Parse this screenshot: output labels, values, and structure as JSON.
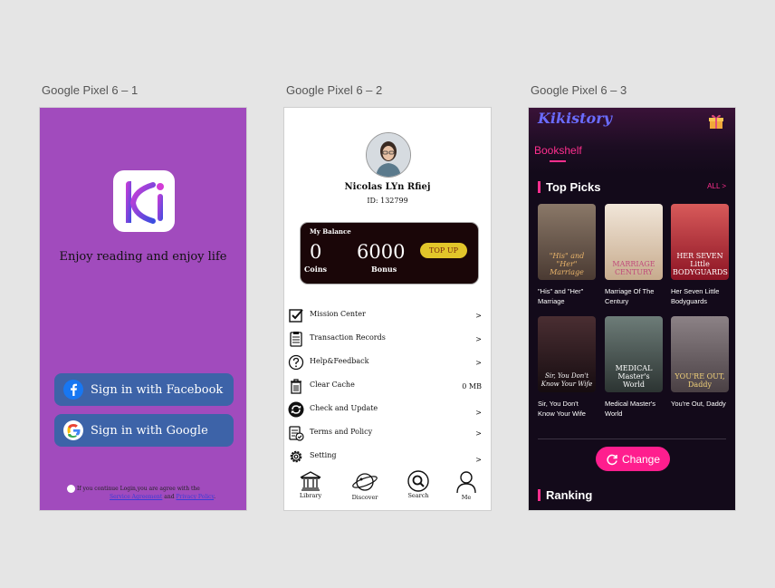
{
  "frames": {
    "f1_label": "Google Pixel 6 – 1",
    "f2_label": "Google Pixel 6 – 2",
    "f3_label": "Google Pixel 6 – 3"
  },
  "login": {
    "tagline": "Enjoy reading and enjoy life",
    "facebook_button": "Sign in with Facebook",
    "google_button": "Sign in with Google",
    "agreement_text": "If you continue Login,you are agree with the",
    "service_link": "Service Agreement",
    "and_text": "and",
    "privacy_link": "Privacy Policy",
    "period": ".",
    "colors": {
      "background": "#a14bbd",
      "button": "#3d63a8"
    }
  },
  "profile": {
    "name": "Nicolas LYn Rfiej",
    "id_text": "ID: 132799",
    "balance": {
      "label": "My Balance",
      "coins_value": "0",
      "coins_label": "Coins",
      "bonus_value": "6000",
      "bonus_label": "Bonus",
      "topup_label": "TOP UP"
    },
    "menu": [
      {
        "label": "Mission Center",
        "right": ">",
        "icon": "checkbox-icon"
      },
      {
        "label": "Transaction Records",
        "right": ">",
        "icon": "clipboard-icon"
      },
      {
        "label": "Help&Feedback",
        "right": ">",
        "icon": "question-icon"
      },
      {
        "label": "Clear Cache",
        "right": "0 MB",
        "icon": "trash-icon"
      },
      {
        "label": "Check and Update",
        "right": ">",
        "icon": "refresh-icon"
      },
      {
        "label": "Terms and Policy",
        "right": ">",
        "icon": "document-check-icon"
      },
      {
        "label": "Setting",
        "right": ">",
        "icon": "gear-icon"
      }
    ],
    "nav": [
      {
        "label": "Library",
        "icon": "library-icon"
      },
      {
        "label": "Discover",
        "icon": "planet-icon"
      },
      {
        "label": "Search",
        "icon": "search-icon"
      },
      {
        "label": "Me",
        "icon": "person-icon"
      }
    ]
  },
  "bookshelf": {
    "brand": "Kikistory",
    "tab": "Bookshelf",
    "top_picks_title": "Top Picks",
    "all_link": "ALL >",
    "books": [
      {
        "title": "\"His\" and \"Her\" Marriage",
        "cover_text": "\"His\" and \"Her\" Marriage",
        "color": "#6d5a4e"
      },
      {
        "title": "Marriage Of The Century",
        "cover_text": "MARRIAGE CENTURY",
        "color": "#d9c8b6"
      },
      {
        "title": "Her Seven Little Bodyguards",
        "cover_text": "HER SEVEN Little BODYGUARDS",
        "color": "#b2283a"
      },
      {
        "title": "Sir, You Don't Know Your Wife",
        "cover_text": "Sir, You Don't Know Your Wife",
        "color": "#2a1c22"
      },
      {
        "title": "Medical Master's World",
        "cover_text": "MEDICAL Master's World",
        "color": "#4c5a5a"
      },
      {
        "title": "You're Out, Daddy",
        "cover_text": "YOU'RE OUT, Daddy",
        "color": "#6f6a6c"
      }
    ],
    "change_button": "Change",
    "ranking_title": "Ranking",
    "colors": {
      "accent": "#ff2f8e",
      "background": "#130a1a"
    }
  }
}
